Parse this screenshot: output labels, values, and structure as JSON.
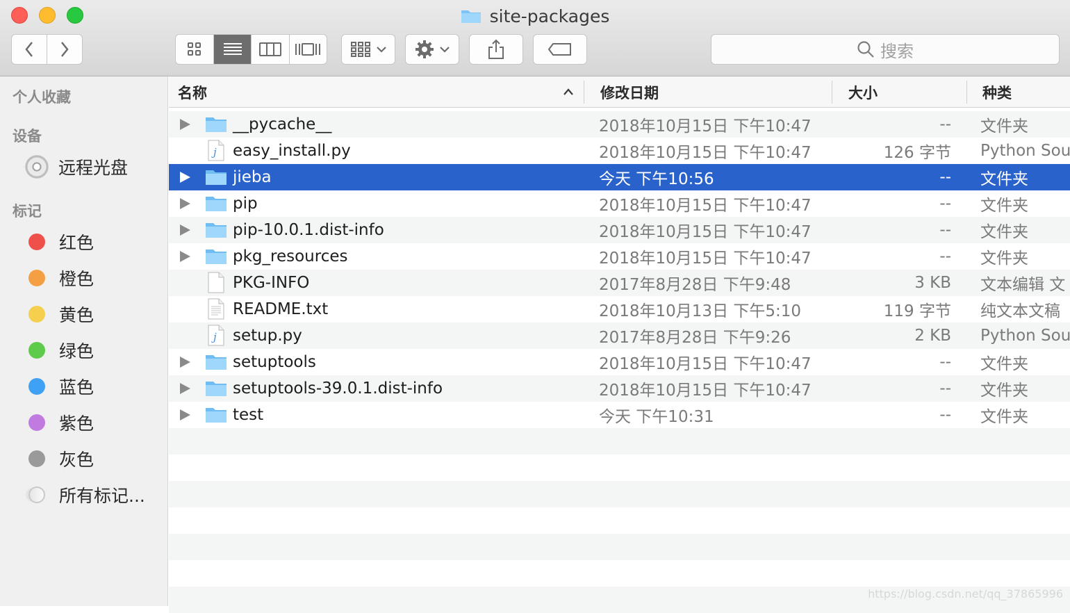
{
  "window": {
    "title": "site-packages"
  },
  "toolbar": {
    "back_icon": "chevron-left-icon",
    "forward_icon": "chevron-right-icon",
    "view_modes": [
      "icon-view-icon",
      "list-view-icon",
      "column-view-icon",
      "gallery-view-icon"
    ],
    "active_view": "list",
    "search_placeholder": "搜索"
  },
  "sidebar": {
    "favorites_heading": "个人收藏",
    "devices_heading": "设备",
    "devices": [
      {
        "label": "远程光盘",
        "icon": "optical-disc-icon"
      }
    ],
    "tags_heading": "标记",
    "tags": [
      {
        "label": "红色",
        "color": "#f0504a"
      },
      {
        "label": "橙色",
        "color": "#f59f45"
      },
      {
        "label": "黄色",
        "color": "#f6cf4e"
      },
      {
        "label": "绿色",
        "color": "#5fcb4c"
      },
      {
        "label": "蓝色",
        "color": "#3fa1f3"
      },
      {
        "label": "紫色",
        "color": "#c17be0"
      },
      {
        "label": "灰色",
        "color": "#9a9a9a"
      },
      {
        "label": "所有标记...",
        "color": ""
      }
    ]
  },
  "list": {
    "columns": {
      "name": "名称",
      "modified": "修改日期",
      "size": "大小",
      "kind": "种类"
    },
    "sort_indicator": "chevron-up-icon",
    "rows": [
      {
        "name": "__pycache__",
        "modified": "2018年10月15日 下午10:47",
        "size": "--",
        "kind": "文件夹",
        "type": "folder"
      },
      {
        "name": "easy_install.py",
        "modified": "2018年10月15日 下午10:47",
        "size": "126 字节",
        "kind": "Python Sou",
        "type": "python"
      },
      {
        "name": "jieba",
        "modified": "今天 下午10:56",
        "size": "--",
        "kind": "文件夹",
        "type": "folder",
        "selected": true
      },
      {
        "name": "pip",
        "modified": "2018年10月15日 下午10:47",
        "size": "--",
        "kind": "文件夹",
        "type": "folder"
      },
      {
        "name": "pip-10.0.1.dist-info",
        "modified": "2018年10月15日 下午10:47",
        "size": "--",
        "kind": "文件夹",
        "type": "folder"
      },
      {
        "name": "pkg_resources",
        "modified": "2018年10月15日 下午10:47",
        "size": "--",
        "kind": "文件夹",
        "type": "folder"
      },
      {
        "name": "PKG-INFO",
        "modified": "2017年8月28日 下午9:48",
        "size": "3 KB",
        "kind": "文本编辑 文",
        "type": "doc"
      },
      {
        "name": "README.txt",
        "modified": "2018年10月13日 下午5:10",
        "size": "119 字节",
        "kind": "纯文本文稿",
        "type": "text"
      },
      {
        "name": "setup.py",
        "modified": "2017年8月28日 下午9:26",
        "size": "2 KB",
        "kind": "Python Sou",
        "type": "python"
      },
      {
        "name": "setuptools",
        "modified": "2018年10月15日 下午10:47",
        "size": "--",
        "kind": "文件夹",
        "type": "folder"
      },
      {
        "name": "setuptools-39.0.1.dist-info",
        "modified": "2018年10月15日 下午10:47",
        "size": "--",
        "kind": "文件夹",
        "type": "folder"
      },
      {
        "name": "test",
        "modified": "今天 下午10:31",
        "size": "--",
        "kind": "文件夹",
        "type": "folder"
      }
    ]
  },
  "watermark": "https://blog.csdn.net/qq_37865996"
}
